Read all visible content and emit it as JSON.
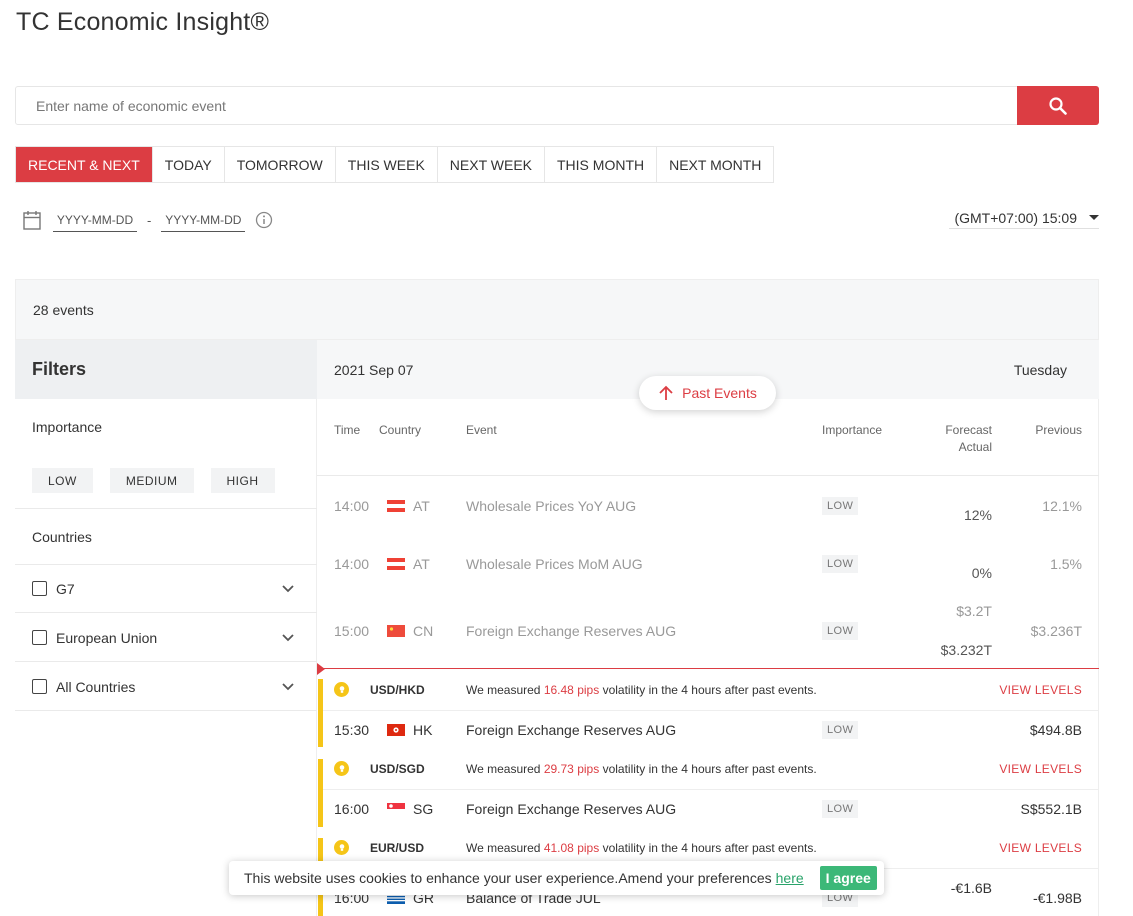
{
  "page": {
    "title": "TC Economic Insight®"
  },
  "search": {
    "placeholder": "Enter name of economic event"
  },
  "tabs": [
    "RECENT & NEXT",
    "TODAY",
    "TOMORROW",
    "THIS WEEK",
    "NEXT WEEK",
    "THIS MONTH",
    "NEXT MONTH"
  ],
  "date_range": {
    "from_placeholder": "YYYY-MM-DD",
    "separator": "-",
    "to_placeholder": "YYYY-MM-DD"
  },
  "timezone": "(GMT+07:00) 15:09",
  "events_count": "28 events",
  "filters": {
    "title": "Filters",
    "importance_title": "Importance",
    "importance_levels": [
      "LOW",
      "MEDIUM",
      "HIGH"
    ],
    "countries_title": "Countries",
    "country_groups": [
      "G7",
      "European Union",
      "All Countries"
    ]
  },
  "day_header": {
    "date": "2021 Sep 07",
    "weekday": "Tuesday"
  },
  "past_events_button": "Past Events",
  "columns": {
    "time": "Time",
    "country": "Country",
    "event": "Event",
    "importance": "Importance",
    "forecast": "Forecast",
    "actual": "Actual",
    "previous": "Previous"
  },
  "past_rows": [
    {
      "time": "14:00",
      "country": "AT",
      "event": "Wholesale Prices YoY AUG",
      "importance": "LOW",
      "forecast": "",
      "actual": "12%",
      "previous": "12.1%"
    },
    {
      "time": "14:00",
      "country": "AT",
      "event": "Wholesale Prices MoM AUG",
      "importance": "LOW",
      "forecast": "",
      "actual": "0%",
      "previous": "1.5%"
    },
    {
      "time": "15:00",
      "country": "CN",
      "event": "Foreign Exchange Reserves AUG",
      "importance": "LOW",
      "forecast": "$3.2T",
      "actual": "$3.232T",
      "previous": "$3.236T"
    }
  ],
  "future_groups": [
    {
      "pair": "USD/HKD",
      "vol_prefix": "We measured",
      "pips": "16.48 pips",
      "vol_suffix": "volatility in the 4 hours after past events.",
      "view": "VIEW LEVELS",
      "row": {
        "time": "15:30",
        "country": "HK",
        "event": "Foreign Exchange Reserves AUG",
        "importance": "LOW",
        "forecast": "",
        "previous": "$494.8B"
      }
    },
    {
      "pair": "USD/SGD",
      "vol_prefix": "We measured",
      "pips": "29.73 pips",
      "vol_suffix": "volatility in the 4 hours after past events.",
      "view": "VIEW LEVELS",
      "row": {
        "time": "16:00",
        "country": "SG",
        "event": "Foreign Exchange Reserves AUG",
        "importance": "LOW",
        "forecast": "",
        "previous": "S$552.1B"
      }
    },
    {
      "pair": "EUR/USD",
      "vol_prefix": "We measured",
      "pips": "41.08 pips",
      "vol_suffix": "volatility in the 4 hours after past events.",
      "view": "VIEW LEVELS",
      "row": {
        "time": "16:00",
        "country": "GR",
        "event": "Balance of Trade JUL",
        "importance": "LOW",
        "forecast": "-€1.6B",
        "previous": "-€1.98B"
      }
    }
  ],
  "cookie": {
    "text": "This website uses cookies to enhance your user experience.Amend your preferences",
    "link": "here",
    "button": "I agree"
  },
  "colors": {
    "accent": "#dc3d43",
    "volatility": "#f5c518",
    "agree": "#3cb878"
  }
}
